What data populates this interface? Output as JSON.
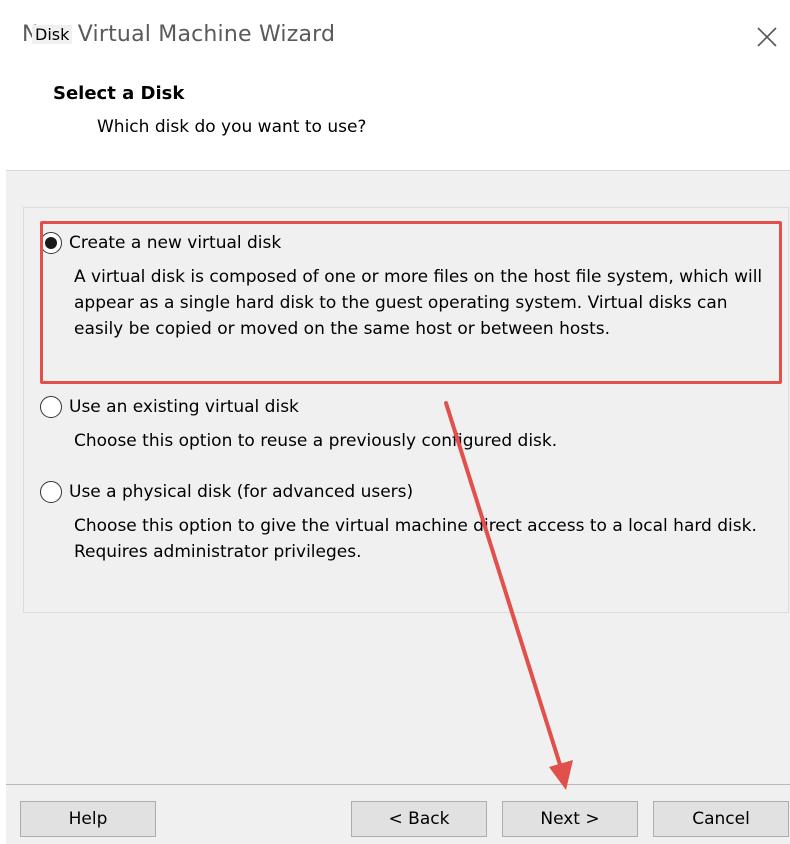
{
  "window": {
    "title": "New Virtual Machine Wizard"
  },
  "header": {
    "title": "Select a Disk",
    "subtitle": "Which disk do you want to use?"
  },
  "disk_group": {
    "legend": "Disk",
    "options": [
      {
        "label": "Create a new virtual disk",
        "selected": true,
        "description": "A virtual disk is composed of one or more files on the host file system, which will appear as a single hard disk to the guest operating system. Virtual disks can easily be copied or moved on the same host or between hosts."
      },
      {
        "label": "Use an existing virtual disk",
        "selected": false,
        "description": "Choose this option to reuse a previously configured disk."
      },
      {
        "label": "Use a physical disk (for advanced users)",
        "selected": false,
        "description": "Choose this option to give the virtual machine direct access to a local hard disk. Requires administrator privileges."
      }
    ]
  },
  "buttons": {
    "help": "Help",
    "back": "< Back",
    "next": "Next >",
    "cancel": "Cancel"
  },
  "annotation": {
    "highlight_color": "#e1504a"
  }
}
